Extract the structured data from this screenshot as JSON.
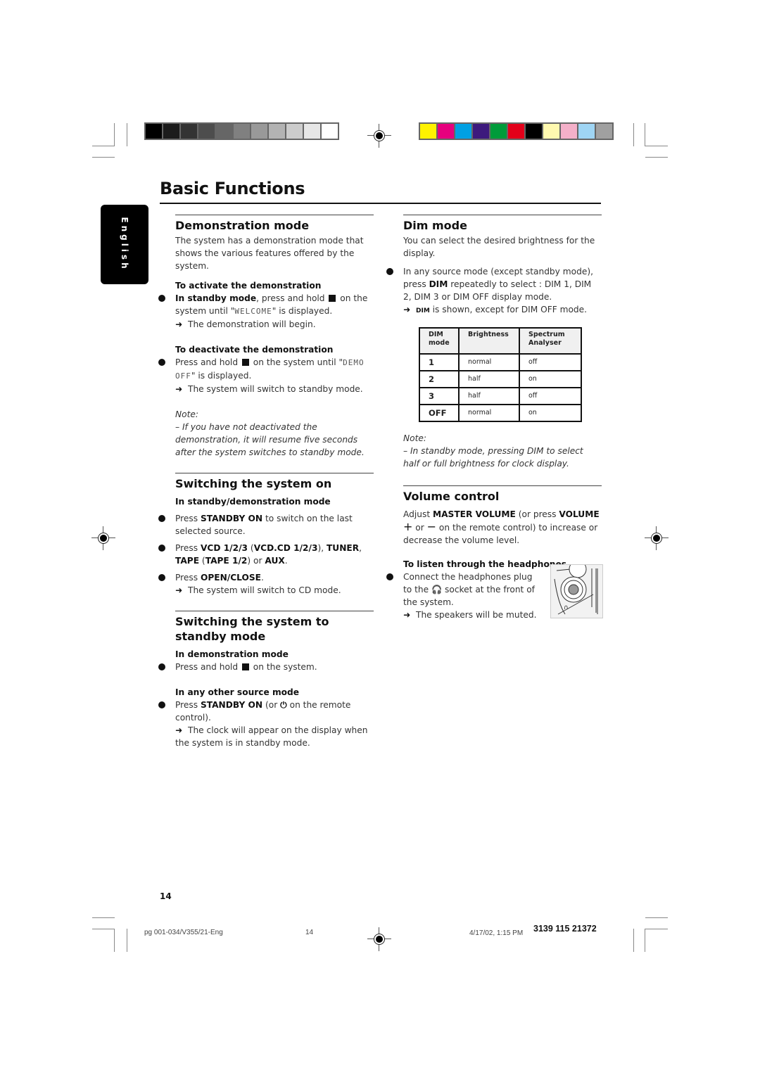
{
  "calibration": {
    "gray_swatches": [
      "#000000",
      "#1c1c1c",
      "#333333",
      "#4d4d4d",
      "#666666",
      "#808080",
      "#999999",
      "#b3b3b3",
      "#cccccc",
      "#e6e6e6",
      "#ffffff"
    ],
    "color_swatches": [
      "#fff200",
      "#e6007e",
      "#00a0e3",
      "#3d1a7d",
      "#009b3a",
      "#e2001a",
      "#000000",
      "#fff9b0",
      "#f4b0c9",
      "#9fd5f4",
      "#a0a0a0"
    ]
  },
  "page_title": "Basic Functions",
  "language_tab": "English",
  "left": {
    "demo": {
      "title": "Demonstration mode",
      "intro": "The system has a demonstration mode that shows the various features offered by the system.",
      "activate_title": "To activate the demonstration",
      "activate_b1": "In standby mode",
      "activate_t1": ", press and hold ",
      "activate_t2": " on the system until \"",
      "activate_lcd": "WELCOME",
      "activate_t3": "\" is displayed.",
      "activate_result": "The demonstration will begin.",
      "deactivate_title": "To deactivate the demonstration",
      "deactivate_t1": "Press and hold ",
      "deactivate_t2": " on the system until \"",
      "deactivate_lcd": "DEMO OFF",
      "deactivate_t3": "\" is displayed.",
      "deactivate_result": "The system will switch to standby mode.",
      "note_label": "Note:",
      "note_text": "–  If you have not deactivated the demonstration, it will resume five seconds after the system switches to standby mode."
    },
    "on": {
      "title": "Switching the system on",
      "sub": "In standby/demonstration mode",
      "b1_pre": "Press ",
      "b1_bold": "STANDBY ON",
      "b1_post": " to switch on the last selected source.",
      "b2_pre": "Press ",
      "b2_b1": "VCD 1/2/3",
      "b2_t1": " (",
      "b2_b2": "VCD.CD 1/2/3",
      "b2_t2": "), ",
      "b2_b3": "TUNER",
      "b2_t3": ", ",
      "b2_b4": "TAPE",
      "b2_t4": " (",
      "b2_b5": "TAPE 1/2",
      "b2_t5": ") or ",
      "b2_b6": "AUX",
      "b2_t6": ".",
      "b3_pre": "Press ",
      "b3_bold": "OPEN/CLOSE",
      "b3_post": ".",
      "b3_result": "The system will switch to CD mode."
    },
    "standby": {
      "title": "Switching the system to standby mode",
      "sub1": "In demonstration mode",
      "b1_pre": "Press and hold ",
      "b1_post": " on the system.",
      "sub2": "In any other source mode",
      "b2_pre": "Press ",
      "b2_bold": "STANDBY ON",
      "b2_mid": " (or ",
      "b2_post": " on the remote control).",
      "b2_result": "The clock will appear on the display when the system is in standby mode."
    }
  },
  "right": {
    "dim": {
      "title": "Dim mode",
      "intro": "You can select the desired brightness for the display.",
      "b1_pre": "In any source mode (except standby mode), press ",
      "b1_bold": "DIM",
      "b1_post": " repeatedly to select : DIM 1, DIM 2, DIM 3 or DIM OFF display mode.",
      "result_tag": "DIM",
      "result_text": " is shown, except for DIM OFF mode.",
      "table": {
        "headers": [
          "DIM mode",
          "Brightness",
          "Spectrum Analyser"
        ],
        "rows": [
          [
            "1",
            "normal",
            "off"
          ],
          [
            "2",
            "half",
            "on"
          ],
          [
            "3",
            "half",
            "off"
          ],
          [
            "OFF",
            "normal",
            "on"
          ]
        ]
      },
      "note_label": "Note:",
      "note_text": "–  In standby mode, pressing DIM to select half or full brightness for clock display."
    },
    "volume": {
      "title": "Volume control",
      "t1": "Adjust ",
      "b1": "MASTER VOLUME",
      "t2": " (or press ",
      "b2": "VOLUME",
      "plus": "+",
      "t3": " or ",
      "minus": "−",
      "t4": " on the remote control) to increase or decrease the volume level.",
      "hp_title": "To listen through the headphones",
      "hp_t1": "Connect the headphones plug to the ",
      "hp_t2": " socket at the front of the system.",
      "hp_result": "The speakers will be muted."
    }
  },
  "page_number": "14",
  "footer": {
    "file": "pg 001-034/V355/21-Eng",
    "page": "14",
    "date": "4/17/02, 1:15 PM",
    "code": "3139 115 21372"
  }
}
